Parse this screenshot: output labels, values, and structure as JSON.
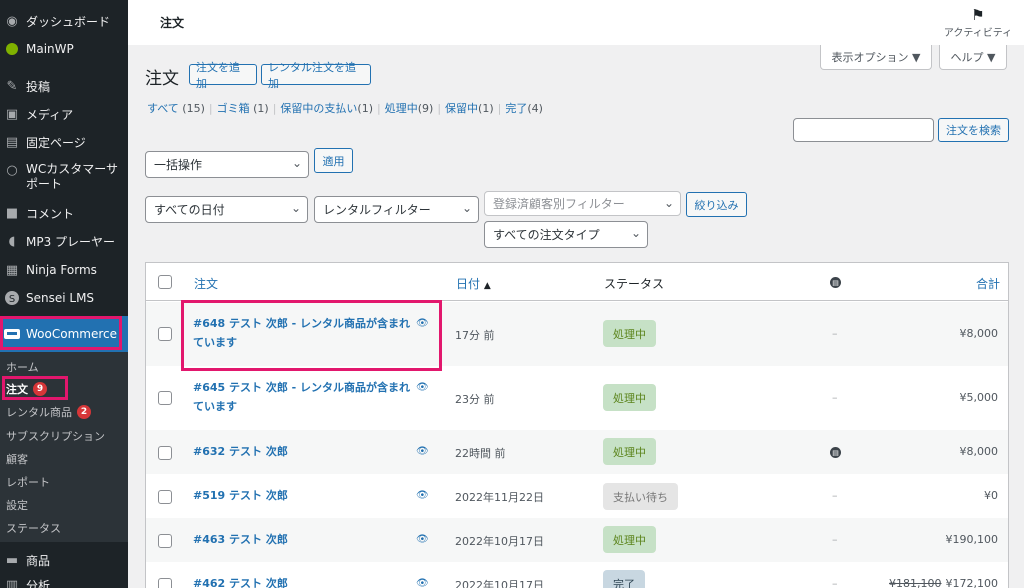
{
  "sidebar": {
    "items": [
      {
        "label": "ダッシュボード",
        "icon": "dashboard-icon"
      },
      {
        "label": "MainWP",
        "icon": "mainwp-icon"
      },
      {
        "label": "投稿",
        "icon": "pin-icon"
      },
      {
        "label": "メディア",
        "icon": "media-icon"
      },
      {
        "label": "固定ページ",
        "icon": "page-icon"
      },
      {
        "label": "WCカスタマーサ",
        "label2": "ポート",
        "icon": "support-icon"
      },
      {
        "label": "コメント",
        "icon": "comment-icon"
      },
      {
        "label": "MP3 プレーヤー",
        "icon": "audio-icon"
      },
      {
        "label": "Ninja Forms",
        "icon": "forms-icon"
      },
      {
        "label": "Sensei LMS",
        "icon": "sensei-icon"
      },
      {
        "label": "WooCommerce",
        "icon": "woo-icon"
      }
    ],
    "submenu": [
      {
        "label": "ホーム"
      },
      {
        "label": "注文",
        "badge": "9"
      },
      {
        "label": "レンタル商品",
        "badge": "2"
      },
      {
        "label": "サブスクリプション"
      },
      {
        "label": "顧客"
      },
      {
        "label": "レポート"
      },
      {
        "label": "設定"
      },
      {
        "label": "ステータス"
      }
    ],
    "bottom": [
      {
        "label": "商品",
        "icon": "products-icon"
      },
      {
        "label": "分析",
        "icon": "analytics-icon"
      }
    ]
  },
  "topbar": {
    "title": "注文",
    "activity": "アクティビティ"
  },
  "screen_options": "表示オプション ▼",
  "help": "ヘルプ ▼",
  "page": {
    "heading": "注文",
    "add_order": "注文を追加",
    "add_rental_order": "レンタル注文を追加"
  },
  "filters_links": [
    {
      "label": "すべて",
      "count": "(15)"
    },
    {
      "label": "ゴミ箱",
      "count": "(1)"
    },
    {
      "label": "保留中の支払い",
      "count": "(1)"
    },
    {
      "label": "処理中",
      "count": "(9)"
    },
    {
      "label": "保留中",
      "count": "(1)"
    },
    {
      "label": "完了",
      "count": "(4)"
    }
  ],
  "search": {
    "button": "注文を検索",
    "value": ""
  },
  "bulk": {
    "select": "一括操作",
    "apply": "適用"
  },
  "filters": {
    "date": "すべての日付",
    "rental": "レンタルフィルター",
    "customer": "登録済顧客別フィルター",
    "filter_button": "絞り込み",
    "order_type": "すべての注文タイプ"
  },
  "table": {
    "headers": {
      "order": "注文",
      "date": "日付",
      "sort_arrow": "▲",
      "status": "ステータス",
      "total": "合計"
    },
    "rows": [
      {
        "order": "#648 テスト 次郎 - レンタル商品が含まれています",
        "date": "17分 前",
        "status": "処理中",
        "status_type": "processing",
        "billing": "–",
        "total": "¥8,000"
      },
      {
        "order": "#645 テスト 次郎 - レンタル商品が含まれています",
        "date": "23分 前",
        "status": "処理中",
        "status_type": "processing",
        "billing": "–",
        "total": "¥5,000"
      },
      {
        "order": "#632 テスト 次郎",
        "date": "22時間 前",
        "status": "処理中",
        "status_type": "processing",
        "billing": "info",
        "total": "¥8,000"
      },
      {
        "order": "#519 テスト 次郎",
        "date": "2022年11月22日",
        "status": "支払い待ち",
        "status_type": "pending",
        "billing": "–",
        "total": "¥0"
      },
      {
        "order": "#463 テスト 次郎",
        "date": "2022年10月17日",
        "status": "処理中",
        "status_type": "processing",
        "billing": "–",
        "total": "¥190,100"
      },
      {
        "order": "#462 テスト 次郎",
        "date": "2022年10月17日",
        "status": "完了",
        "status_type": "complete",
        "billing": "–",
        "total_old": "¥181,100",
        "total": "¥172,100"
      }
    ]
  },
  "colors": {
    "highlight": "#e2176d",
    "accent": "#2271b1",
    "sidebar": "#1d2327"
  }
}
